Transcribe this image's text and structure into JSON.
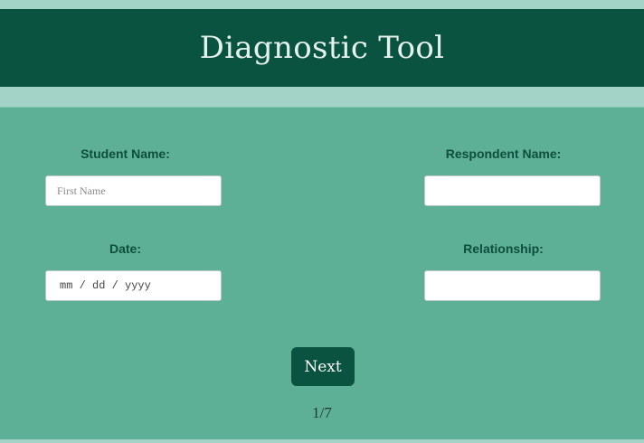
{
  "header": {
    "title": "Diagnostic Tool"
  },
  "form": {
    "student_name": {
      "label": "Student Name:",
      "value": "",
      "placeholder": "First Name"
    },
    "respondent_name": {
      "label": "Respondent Name:",
      "value": "",
      "placeholder": ""
    },
    "date": {
      "label": "Date:",
      "value": "",
      "placeholder": "mm / dd / yyyy"
    },
    "relationship": {
      "label": "Relationship:",
      "value": "",
      "placeholder": ""
    }
  },
  "navigation": {
    "next_label": "Next",
    "page_indicator": "1/7"
  },
  "colors": {
    "header_bg": "#0b5341",
    "main_bg": "#5db095",
    "strip_bg": "#a3d2c6",
    "label_text": "#0d4f3c",
    "button_bg": "#0b5341"
  }
}
